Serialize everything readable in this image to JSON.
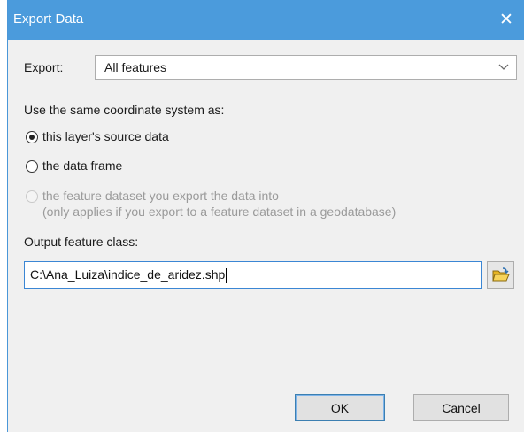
{
  "window": {
    "title": "Export Data",
    "close_glyph": "✕",
    "close_icon": "close-icon"
  },
  "export": {
    "label": "Export:",
    "selected": "All features",
    "dropdown_icon": "chevron-down-icon"
  },
  "coordinate": {
    "heading": "Use the same coordinate system as:",
    "options": [
      {
        "label": "this layer's source data",
        "checked": true,
        "enabled": true
      },
      {
        "label": "the data frame",
        "checked": false,
        "enabled": true
      },
      {
        "label": "the feature dataset you export the data into",
        "sublabel": "(only applies if you export to a feature dataset in a geodatabase)",
        "checked": false,
        "enabled": false
      }
    ]
  },
  "output": {
    "label": "Output feature class:",
    "value": "C:\\Ana_Luiza\\indice_de_aridez.shp",
    "browse_icon": "open-folder-icon"
  },
  "buttons": {
    "ok": "OK",
    "cancel": "Cancel"
  },
  "colors": {
    "titlebar": "#4b9bdc",
    "dialog_bg": "#f0f0f0",
    "input_focus": "#3b86d4"
  }
}
